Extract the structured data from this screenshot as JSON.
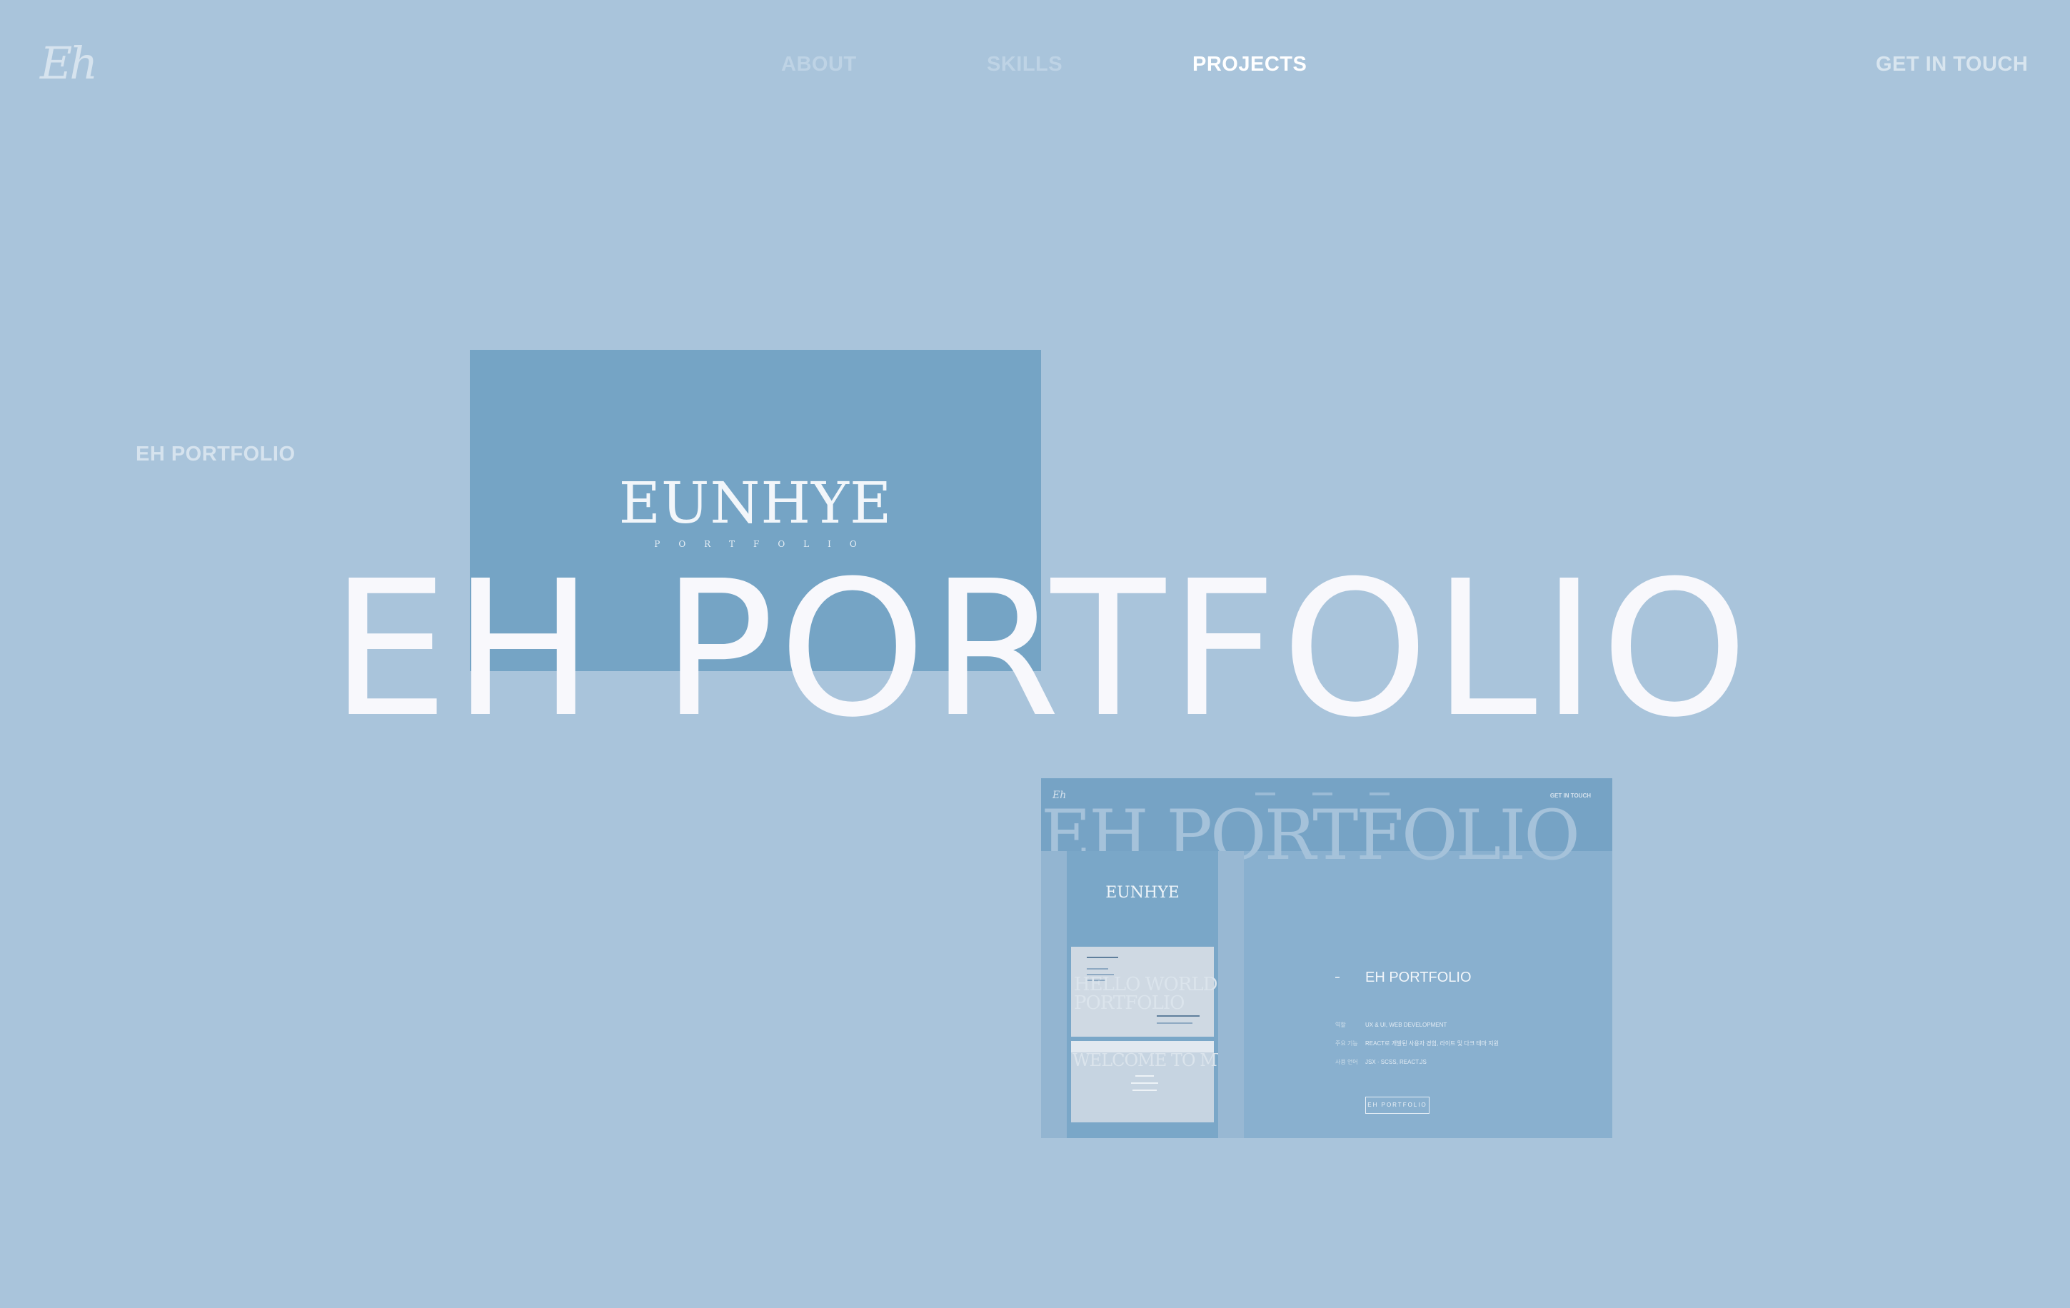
{
  "header": {
    "logo": "Eh",
    "nav": [
      {
        "label": "ABOUT"
      },
      {
        "label": "SKILLS"
      },
      {
        "label": "PROJECTS"
      }
    ],
    "contact": "GET IN TOUCH"
  },
  "project": {
    "label": "EH PORTFOLIO",
    "title": "EH PORTFOLIO",
    "card1": {
      "brand": "EUNHYE",
      "sub": "PORTFOLIO"
    },
    "card2": {
      "logo": "Eh",
      "contact": "GET IN TOUCH",
      "ghost": "EH PORTFOLIO",
      "phone_brand": "EUNHYE",
      "info_title": "EH PORTFOLIO",
      "rows": [
        {
          "k": "역할",
          "v": "UX & UI, WEB DEVELOPMENT"
        },
        {
          "k": "주요 기능",
          "v": "REACT로 개발된 사용자 경험, 라이트 및 다크 테마 지원"
        },
        {
          "k": "사용 언어",
          "v": "JSX · SCSS, REACT.JS"
        }
      ],
      "button": "EH PORTFOLIO"
    }
  },
  "colors": {
    "background": "#a9c4db",
    "card": "#75a4c5",
    "active_nav": "#ffffff"
  }
}
